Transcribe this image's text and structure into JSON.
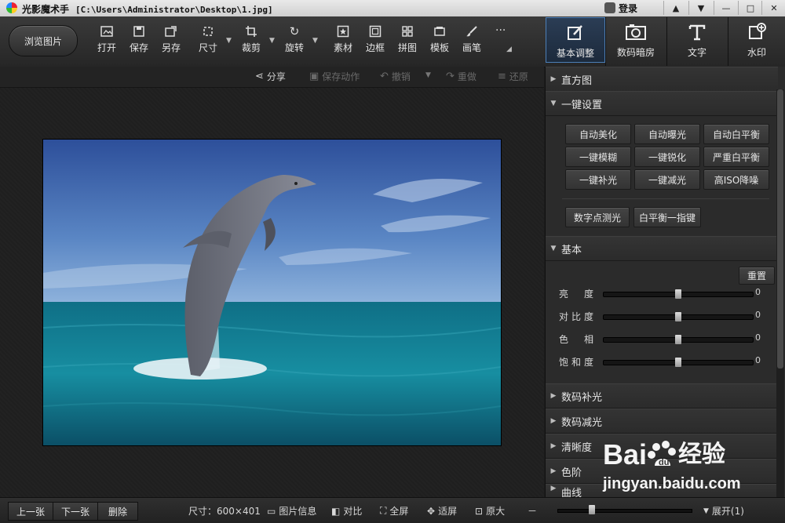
{
  "app": {
    "name": "光影魔术手",
    "path": "[C:\\Users\\Administrator\\Desktop\\1.jpg]",
    "login_label": "登录"
  },
  "toolbar": {
    "browse_label": "浏览图片",
    "tools": [
      {
        "label": "打开",
        "icon": "open-icon"
      },
      {
        "label": "保存",
        "icon": "save-icon"
      },
      {
        "label": "另存",
        "icon": "save-as-icon"
      },
      {
        "label": "尺寸",
        "icon": "resize-icon"
      },
      {
        "label": "裁剪",
        "icon": "crop-icon"
      },
      {
        "label": "旋转",
        "icon": "rotate-icon"
      },
      {
        "label": "素材",
        "icon": "material-icon"
      },
      {
        "label": "边框",
        "icon": "frame-icon"
      },
      {
        "label": "拼图",
        "icon": "collage-icon"
      },
      {
        "label": "模板",
        "icon": "template-icon"
      },
      {
        "label": "画笔",
        "icon": "brush-icon"
      }
    ],
    "right_tabs": [
      {
        "label": "基本调整",
        "icon": "edit-icon"
      },
      {
        "label": "数码暗房",
        "icon": "camera-icon"
      },
      {
        "label": "文字",
        "icon": "text-icon"
      },
      {
        "label": "水印",
        "icon": "watermark-icon"
      }
    ]
  },
  "actions": {
    "share": "分享",
    "save_action": "保存动作",
    "undo": "撤销",
    "redo": "重做",
    "restore": "还原"
  },
  "panel": {
    "histogram": "直方图",
    "oneclick": "一键设置",
    "oneclick_buttons": [
      "自动美化",
      "自动曝光",
      "自动白平衡",
      "一键模糊",
      "一键锐化",
      "严重白平衡",
      "一键补光",
      "一键减光",
      "高ISO降噪"
    ],
    "extra_buttons": [
      "数字点测光",
      "白平衡一指键"
    ],
    "basic": "基本",
    "reset": "重置",
    "sliders": [
      {
        "label": "亮　度",
        "value": "0",
        "level": 0.5
      },
      {
        "label": "对比度",
        "value": "0",
        "level": 0.5
      },
      {
        "label": "色　相",
        "value": "0",
        "level": 0.5
      },
      {
        "label": "饱和度",
        "value": "0",
        "level": 0.5
      }
    ],
    "collapsed_sections": [
      "数码补光",
      "数码减光",
      "清晰度",
      "色阶",
      "曲线"
    ]
  },
  "status": {
    "prev": "上一张",
    "next": "下一张",
    "delete": "删除",
    "size": "尺寸：600×401",
    "info": "图片信息",
    "compare": "对比",
    "fullscreen": "全屏",
    "fit": "适屏",
    "original": "原大",
    "expand": "展开(1)",
    "zoom_level": 0.25
  },
  "watermark": {
    "brand": "Bai",
    "brand2": "经验",
    "url": "jingyan.baidu.com"
  }
}
